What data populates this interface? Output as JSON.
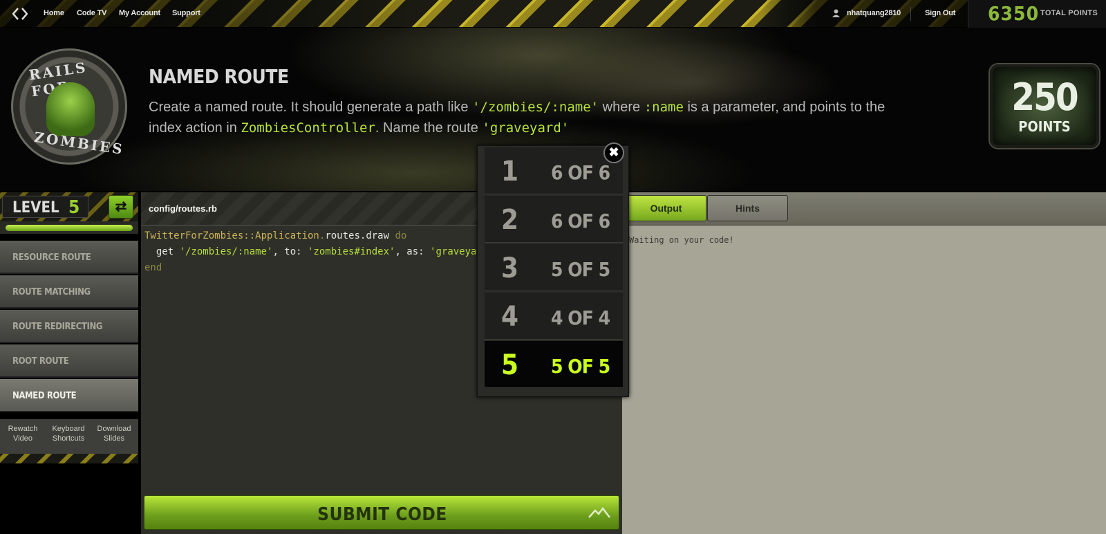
{
  "nav": {
    "links": [
      "Home",
      "Code TV",
      "My Account",
      "Support"
    ],
    "username": "nhatquang2810",
    "sign_out": "Sign Out",
    "total_points": "6350",
    "total_points_label": "TOTAL POINTS"
  },
  "badge": {
    "top": "RAILS FOR",
    "bottom": "ZOMBIES"
  },
  "challenge": {
    "title": "NAMED ROUTE",
    "desc_parts": [
      {
        "t": "Create a named route. It should generate a path like ",
        "code": false
      },
      {
        "t": "'/zombies/:name'",
        "code": true
      },
      {
        "t": " where ",
        "code": false
      },
      {
        "t": ":name",
        "code": true
      },
      {
        "t": " is a parameter, and points to the index action in ",
        "code": false
      },
      {
        "t": "ZombiesController",
        "code": true
      },
      {
        "t": ". Name the route ",
        "code": false
      },
      {
        "t": "'graveyard'",
        "code": true
      }
    ],
    "points": "250",
    "points_label": "POINTS"
  },
  "sidebar": {
    "level_label": "LEVEL",
    "level_num": "5",
    "progress": 1.0,
    "items": [
      "RESOURCE ROUTE",
      "ROUTE MATCHING",
      "ROUTE REDIRECTING",
      "ROOT ROUTE",
      "NAMED ROUTE"
    ],
    "active_item": "NAMED ROUTE",
    "links": [
      "Rewatch Video",
      "Keyboard Shortcuts",
      "Download Slides"
    ]
  },
  "editor": {
    "filename": "config/routes.rb",
    "line1_cls": "TwitterForZombies::Application",
    "line1_dot": ".",
    "line1_rest": "routes.draw",
    "line1_kw": "do",
    "line2_pre": "  get ",
    "line2_s1": "'/zombies/:name'",
    "line2_m1": ", to: ",
    "line2_s2": "'zombies#index'",
    "line2_m2": ", as: ",
    "line2_s3": "'graveyard'",
    "line3_kw": "end",
    "submit": "SUBMIT CODE"
  },
  "output": {
    "tabs": [
      "Output",
      "Hints"
    ],
    "active_tab": "Output",
    "text": "Waiting on your code!"
  },
  "popup": {
    "rows": [
      {
        "num": "1",
        "count": "6 OF 6"
      },
      {
        "num": "2",
        "count": "6 OF 6"
      },
      {
        "num": "3",
        "count": "5 OF 5"
      },
      {
        "num": "4",
        "count": "4 OF 4"
      },
      {
        "num": "5",
        "count": "5 OF 5"
      }
    ],
    "active": "5"
  },
  "icons": {
    "close": "close-icon",
    "switch": "switch-arrows-icon",
    "user": "user-icon",
    "logo": "code-brackets-icon",
    "submit": "mountain-icon"
  }
}
